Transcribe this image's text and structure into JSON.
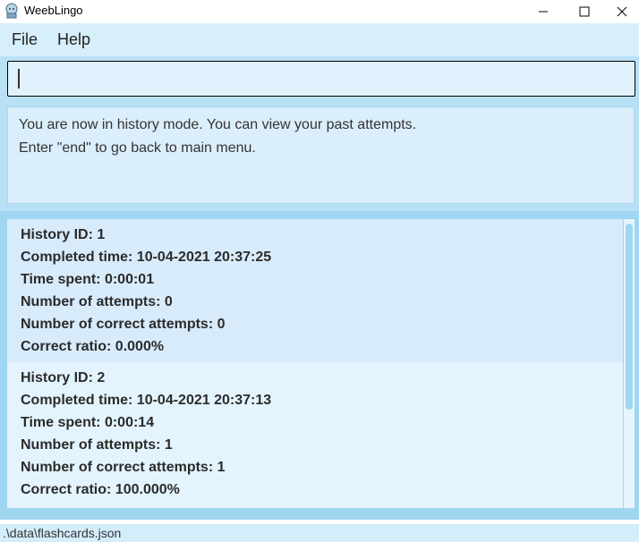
{
  "window": {
    "title": "WeebLingo",
    "icon": "app-icon"
  },
  "menu": {
    "items": [
      "File",
      "Help"
    ]
  },
  "command": {
    "value": "",
    "placeholder": ""
  },
  "result": {
    "lines": [
      "You are now in history mode. You can view your past attempts.",
      "Enter \"end\" to go back to main menu."
    ]
  },
  "history": {
    "entries": [
      {
        "id_line": "History ID: 1",
        "completed_line": "Completed time: 10-04-2021 20:37:25",
        "time_spent_line": "Time spent: 0:00:01",
        "attempts_line": "Number of attempts: 0",
        "correct_attempts_line": "Number of correct attempts: 0",
        "ratio_line": "Correct ratio: 0.000%"
      },
      {
        "id_line": "History ID: 2",
        "completed_line": "Completed time: 10-04-2021 20:37:13",
        "time_spent_line": "Time spent: 0:00:14",
        "attempts_line": "Number of attempts: 1",
        "correct_attempts_line": "Number of correct attempts: 1",
        "ratio_line": "Correct ratio: 100.000%"
      }
    ]
  },
  "status": {
    "path": ".\\data\\flashcards.json"
  },
  "colors": {
    "menubar": "#d7effb",
    "panel": "#b9e1f6",
    "list_frame": "#9fd6f1",
    "card_selected": "#d8ebfb",
    "card": "#e4f4fe"
  }
}
